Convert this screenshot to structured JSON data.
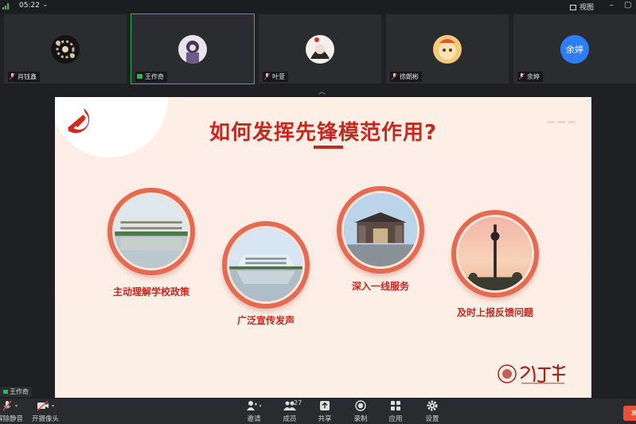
{
  "status": {
    "time": "05:22",
    "view_label": "视图"
  },
  "participants": [
    {
      "name": "肖钰鑫",
      "active": false,
      "initials": ""
    },
    {
      "name": "王作奇",
      "active": true,
      "initials": ""
    },
    {
      "name": "叶萱",
      "active": false,
      "initials": ""
    },
    {
      "name": "徐朗彬",
      "active": false,
      "initials": ""
    },
    {
      "name": "余婷",
      "active": false,
      "initials": "余婷"
    }
  ],
  "slide": {
    "title": "如何发挥先锋模范作用?",
    "items": [
      {
        "label": "主动理解学校政策"
      },
      {
        "label": "广泛宣传发声"
      },
      {
        "label": "深入一线服务"
      },
      {
        "label": "及时上报反馈问题"
      }
    ]
  },
  "self_tag": "王作奇",
  "toolbar": {
    "mute_label": "解除静音",
    "camera_label": "开摄像头",
    "invite_label": "邀请",
    "members_label": "成员",
    "members_count": "27",
    "share_label": "共享",
    "record_label": "录制",
    "apps_label": "应用",
    "settings_label": "设置",
    "leave_label": "离"
  },
  "colors": {
    "accent_green": "#2cb55a",
    "slide_red": "#c4281f",
    "avatar_blue": "#2f7dff"
  },
  "icons": [
    "signal-icon",
    "chevron-down-icon",
    "grid-view-icon",
    "minimize-icon",
    "maximize-icon",
    "mic-muted-icon",
    "camera-off-icon",
    "invite-icon",
    "members-icon",
    "share-screen-icon",
    "record-icon",
    "apps-icon",
    "settings-icon",
    "party-emblem-icon",
    "university-logo"
  ]
}
